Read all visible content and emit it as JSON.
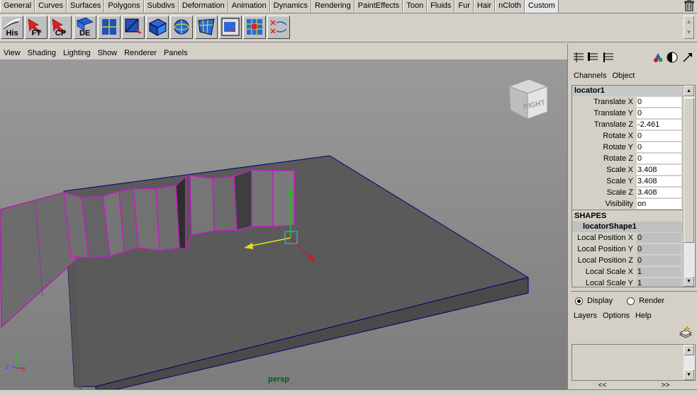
{
  "shelf_tabs": [
    "General",
    "Curves",
    "Surfaces",
    "Polygons",
    "Subdivs",
    "Deformation",
    "Animation",
    "Dynamics",
    "Rendering",
    "PaintEffects",
    "Toon",
    "Fluids",
    "Fur",
    "Hair",
    "nCloth",
    "Custom"
  ],
  "active_tab": "Custom",
  "shelf_tools": [
    {
      "label": "His",
      "icon": "history-tool-icon"
    },
    {
      "label": "FT",
      "icon": "freeze-transform-icon"
    },
    {
      "label": "CP",
      "icon": "center-pivot-icon"
    },
    {
      "label": "DE",
      "icon": "delete-icon"
    },
    {
      "label": "",
      "icon": "uv-layout-icon"
    },
    {
      "label": "",
      "icon": "select-uv-icon"
    },
    {
      "label": "",
      "icon": "cube-map-icon"
    },
    {
      "label": "",
      "icon": "sphere-map-icon"
    },
    {
      "label": "",
      "icon": "unfold-uv-icon"
    },
    {
      "label": "",
      "icon": "uv-editor-icon"
    },
    {
      "label": "",
      "icon": "checker-map-icon"
    },
    {
      "label": "",
      "icon": "cut-uv-icon"
    }
  ],
  "panel_menu": [
    "View",
    "Shading",
    "Lighting",
    "Show",
    "Renderer",
    "Panels"
  ],
  "viewport": {
    "camera_name": "persp",
    "view_cube_label": "RIGHT",
    "axis_labels": {
      "x": "x",
      "y": "y",
      "z": "z"
    },
    "colors": {
      "background": "#8a8a8a",
      "ground": "#595959",
      "wall": "#6e6e6e",
      "selection": "#c020c0",
      "edge": "#000080"
    }
  },
  "channel_box": {
    "menu": [
      "Channels",
      "Object"
    ],
    "object_name": "locator1",
    "channels": [
      {
        "label": "Translate X",
        "value": "0"
      },
      {
        "label": "Translate Y",
        "value": "0"
      },
      {
        "label": "Translate Z",
        "value": "-2.461"
      },
      {
        "label": "Rotate X",
        "value": "0"
      },
      {
        "label": "Rotate Y",
        "value": "0"
      },
      {
        "label": "Rotate Z",
        "value": "0"
      },
      {
        "label": "Scale X",
        "value": "3.408"
      },
      {
        "label": "Scale Y",
        "value": "3.408"
      },
      {
        "label": "Scale Z",
        "value": "3.408"
      },
      {
        "label": "Visibility",
        "value": "on"
      }
    ],
    "shapes_header": "SHAPES",
    "shape_name": "locatorShape1",
    "shape_channels": [
      {
        "label": "Local Position X",
        "value": "0"
      },
      {
        "label": "Local Position Y",
        "value": "0"
      },
      {
        "label": "Local Position Z",
        "value": "0"
      },
      {
        "label": "Local Scale X",
        "value": "1"
      },
      {
        "label": "Local Scale Y",
        "value": "1"
      }
    ]
  },
  "layer_editor": {
    "modes": [
      {
        "label": "Display",
        "selected": true
      },
      {
        "label": "Render",
        "selected": false
      }
    ],
    "menu": [
      "Layers",
      "Options",
      "Help"
    ],
    "nav": [
      "<<",
      ">>"
    ]
  }
}
